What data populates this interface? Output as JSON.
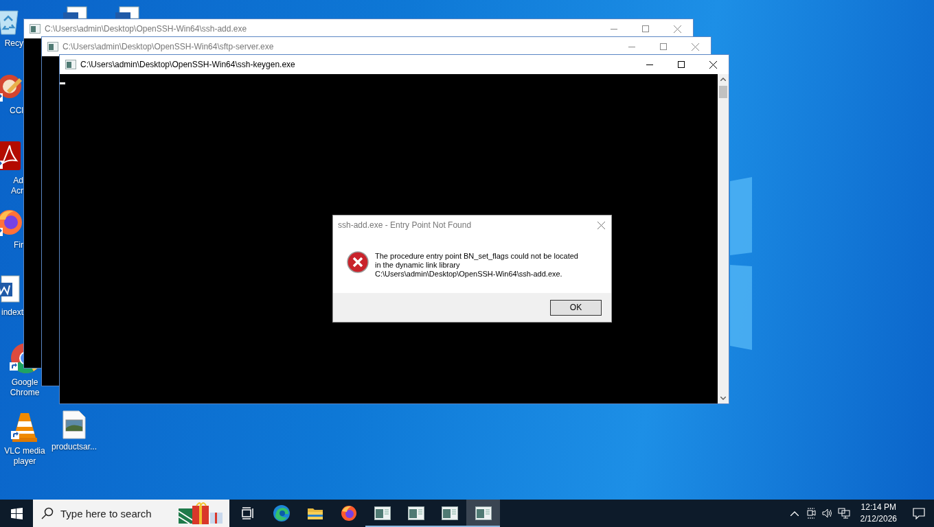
{
  "desktop": {
    "icons": [
      {
        "kind": "recycle-bin",
        "label": "Recy",
        "cut": true
      },
      {
        "kind": "cleaner",
        "label": "CCl",
        "cut": true
      },
      {
        "kind": "pdf",
        "label": "Ad\nAcr",
        "cut": true
      },
      {
        "kind": "firefox",
        "label": "Fir",
        "cut": true
      },
      {
        "kind": "word",
        "label": "indext",
        "cut": true
      },
      {
        "kind": "chrome",
        "label": "Google Chrome",
        "cut": false
      },
      {
        "kind": "vlc",
        "label": "VLC media player",
        "cut": false
      },
      {
        "kind": "image-file",
        "label": "productsar...",
        "cut": false
      }
    ]
  },
  "windows": [
    {
      "title": "C:\\Users\\admin\\Desktop\\OpenSSH-Win64\\ssh-add.exe",
      "active": false
    },
    {
      "title": "C:\\Users\\admin\\Desktop\\OpenSSH-Win64\\sftp-server.exe",
      "active": false
    },
    {
      "title": "C:\\Users\\admin\\Desktop\\OpenSSH-Win64\\ssh-keygen.exe",
      "active": true
    }
  ],
  "dialog": {
    "title": "ssh-add.exe - Entry Point Not Found",
    "message": "The procedure entry point BN_set_flags could not be located\nin the dynamic link library\nC:\\Users\\admin\\Desktop\\OpenSSH-Win64\\ssh-add.exe.",
    "button": "OK"
  },
  "taskbar": {
    "search": {
      "placeholder": "Type here to search"
    },
    "apps": [
      {
        "kind": "task-view",
        "running": false,
        "selected": false
      },
      {
        "kind": "edge",
        "running": false,
        "selected": false
      },
      {
        "kind": "folder",
        "running": false,
        "selected": false
      },
      {
        "kind": "firefox",
        "running": false,
        "selected": false
      },
      {
        "kind": "console",
        "running": true,
        "selected": false
      },
      {
        "kind": "console",
        "running": true,
        "selected": false
      },
      {
        "kind": "console",
        "running": true,
        "selected": false
      },
      {
        "kind": "console",
        "running": true,
        "selected": true
      }
    ],
    "clock": {
      "time": "12:14 PM",
      "date": "2/12/2026"
    }
  }
}
